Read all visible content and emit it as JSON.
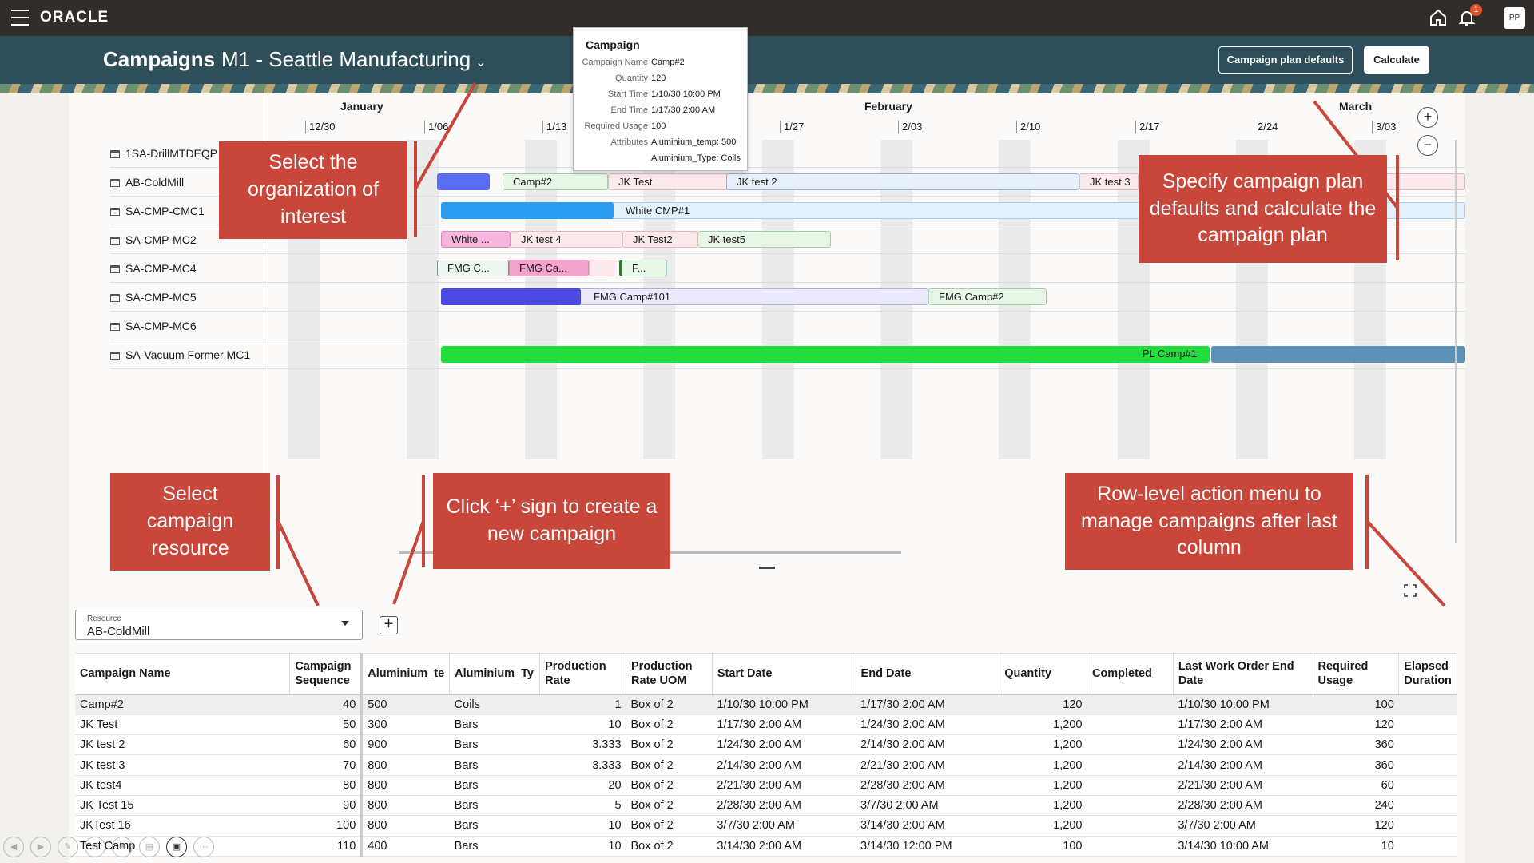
{
  "topbar": {
    "brand": "ORACLE",
    "notification_count": "1",
    "user_initials": "PP",
    "icons": [
      "menu-icon",
      "home-icon",
      "bell-icon"
    ]
  },
  "header": {
    "title": "Campaigns",
    "organization": "M1 - Seattle Manufacturing",
    "campaign_plan_defaults_label": "Campaign plan defaults",
    "calculate_label": "Calculate"
  },
  "gantt": {
    "months": [
      "January",
      "February",
      "March"
    ],
    "weeks": [
      "12/30",
      "1/06",
      "1/13",
      "1/27",
      "2/03",
      "2/10",
      "2/17",
      "2/24",
      "3/03"
    ],
    "zoom_in": "+",
    "zoom_out": "−",
    "resources": [
      {
        "name": "1SA-DrillMTDEQP"
      },
      {
        "name": "AB-ColdMill"
      },
      {
        "name": "SA-CMP-CMC1"
      },
      {
        "name": "SA-CMP-MC2"
      },
      {
        "name": "SA-CMP-MC4"
      },
      {
        "name": "SA-CMP-MC5"
      },
      {
        "name": "SA-CMP-MC6"
      },
      {
        "name": "SA-Vacuum Former MC1"
      }
    ],
    "bars": {
      "coldmill": [
        "Camp#2",
        "JK Test",
        "JK test 2",
        "JK test 3"
      ],
      "cmc1": [
        "White CMP#1"
      ],
      "mc2": [
        "White ...",
        "JK test 4",
        "JK Test2",
        "JK test5"
      ],
      "mc4": [
        "FMG C...",
        "FMG Ca...",
        "F..."
      ],
      "mc5": [
        "FMG Camp#101",
        "FMG Camp#2"
      ],
      "vacuum": [
        "PL Camp#1"
      ]
    },
    "colors": {
      "coldmill_bar": "#e8f6e8",
      "progress_blue": "#5a6cf0",
      "cmc1_progress": "#2b9cf0",
      "mc5_progress": "#4a4ae0",
      "vacuum_green": "#22dd3c",
      "vacuum_steel": "#5b92b5"
    }
  },
  "tooltip": {
    "title": "Campaign",
    "rows": [
      {
        "k": "Campaign Name",
        "v": "Camp#2"
      },
      {
        "k": "Quantity",
        "v": "120"
      },
      {
        "k": "Start Time",
        "v": "1/10/30 10:00 PM"
      },
      {
        "k": "End Time",
        "v": "1/17/30 2:00 AM"
      },
      {
        "k": "Required Usage",
        "v": "100"
      },
      {
        "k": "Attributes",
        "v": "Aluminium_temp: 500"
      },
      {
        "k": "",
        "v": "Aluminium_Type: Coils"
      }
    ]
  },
  "callouts": {
    "org": "Select the organization of interest",
    "defaults": "Specify campaign plan defaults and calculate the campaign plan",
    "resource": "Select campaign resource",
    "plus": "Click ‘+’ sign to create a new campaign",
    "rowmenu": "Row-level action menu to manage campaigns after last column"
  },
  "resource_select": {
    "label": "Resource",
    "value": "AB-ColdMill"
  },
  "add_button": "+",
  "table": {
    "headers": [
      "Campaign Name",
      "Campaign Sequence",
      "Aluminium_te",
      "Aluminium_Ty",
      "Production Rate",
      "Production Rate UOM",
      "Start Date",
      "End Date",
      "Quantity",
      "Completed",
      "Last Work Order End Date",
      "Required Usage",
      "Elapsed Duration"
    ],
    "rows": [
      [
        "Camp#2",
        "40",
        "500",
        "Coils",
        "1",
        "Box of 2",
        "1/10/30 10:00 PM",
        "1/17/30 2:00 AM",
        "120",
        "",
        "1/10/30 10:00 PM",
        "100",
        ""
      ],
      [
        "JK Test",
        "50",
        "300",
        "Bars",
        "10",
        "Box of 2",
        "1/17/30 2:00 AM",
        "1/24/30 2:00 AM",
        "1,200",
        "",
        "1/17/30 2:00 AM",
        "120",
        ""
      ],
      [
        "JK test 2",
        "60",
        "900",
        "Bars",
        "3.333",
        "Box of 2",
        "1/24/30 2:00 AM",
        "2/14/30 2:00 AM",
        "1,200",
        "",
        "1/24/30 2:00 AM",
        "360",
        ""
      ],
      [
        "JK test 3",
        "70",
        "800",
        "Bars",
        "3.333",
        "Box of 2",
        "2/14/30 2:00 AM",
        "2/21/30 2:00 AM",
        "1,200",
        "",
        "2/14/30 2:00 AM",
        "360",
        ""
      ],
      [
        "JK test4",
        "80",
        "800",
        "Bars",
        "20",
        "Box of 2",
        "2/21/30 2:00 AM",
        "2/28/30 2:00 AM",
        "1,200",
        "",
        "2/21/30 2:00 AM",
        "60",
        ""
      ],
      [
        "JK Test 15",
        "90",
        "800",
        "Bars",
        "5",
        "Box of 2",
        "2/28/30 2:00 AM",
        "3/7/30 2:00 AM",
        "1,200",
        "",
        "2/28/30 2:00 AM",
        "240",
        ""
      ],
      [
        "JKTest 16",
        "100",
        "800",
        "Bars",
        "10",
        "Box of 2",
        "3/7/30 2:00 AM",
        "3/14/30 2:00 AM",
        "1,200",
        "",
        "3/7/30 2:00 AM",
        "120",
        ""
      ],
      [
        "Test Camp",
        "110",
        "400",
        "Bars",
        "10",
        "Box of 2",
        "3/14/30 2:00 AM",
        "3/14/30 12:00 PM",
        "100",
        "",
        "3/14/30 10:00 AM",
        "10",
        ""
      ]
    ]
  }
}
